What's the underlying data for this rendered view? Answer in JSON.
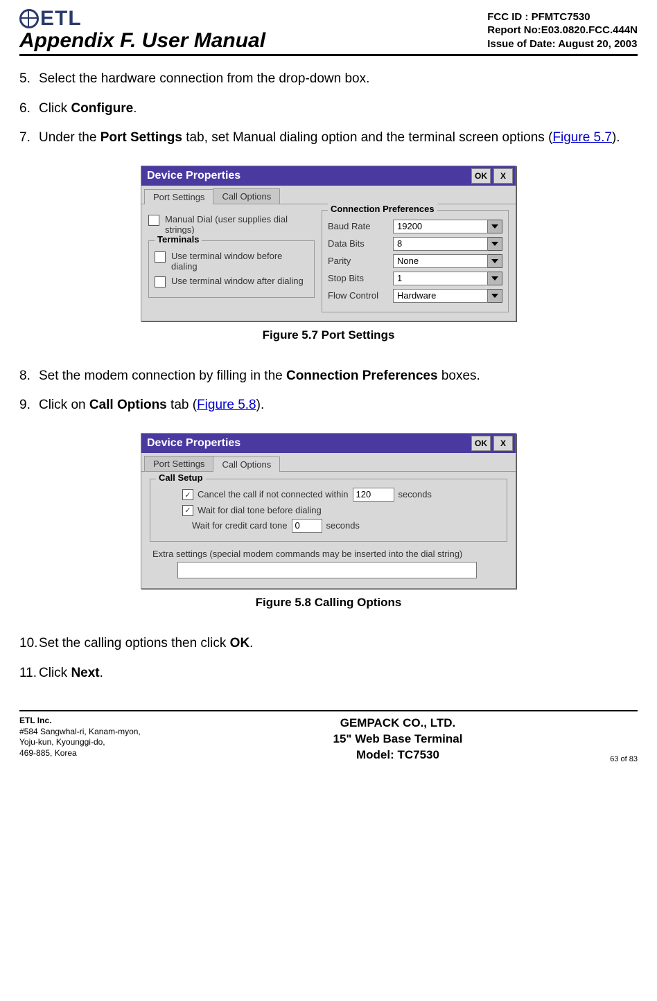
{
  "header": {
    "logo_text": "ETL",
    "title": "Appendix F. User Manual",
    "fcc_id": "FCC ID : PFMTC7530",
    "report_no": "Report No:E03.0820.FCC.444N",
    "issue_date": "Issue of Date:  August 20, 2003"
  },
  "steps": {
    "s5": "Select the hardware connection from the drop-down box.",
    "s6_pre": "Click ",
    "s6_b": "Configure",
    "s6_post": ".",
    "s7_pre": "Under the ",
    "s7_b": "Port Settings",
    "s7_mid": " tab, set Manual dialing option and the terminal screen options (",
    "s7_link": "Figure 5.7",
    "s7_post": ").",
    "s8_pre": "Set the modem connection by filling in the ",
    "s8_b": "Connection Preferences",
    "s8_post": " boxes.",
    "s9_pre": "Click on ",
    "s9_b": "Call Options",
    "s9_mid": " tab (",
    "s9_link": "Figure 5.8",
    "s9_post": ").",
    "s10_pre": "Set the calling options then click ",
    "s10_b": "OK",
    "s10_post": ".",
    "s11_pre": "Click ",
    "s11_b": "Next",
    "s11_post": "."
  },
  "fig57": {
    "caption": "Figure 5.7    Port Settings",
    "title": "Device Properties",
    "ok": "OK",
    "close": "X",
    "tab1": "Port Settings",
    "tab2": "Call Options",
    "manual_dial": "Manual Dial (user supplies dial strings)",
    "terminals_legend": "Terminals",
    "term_before": "Use terminal window before dialing",
    "term_after": "Use terminal window after dialing",
    "conn_pref_legend": "Connection Preferences",
    "baud_lbl": "Baud Rate",
    "baud_val": "19200",
    "databits_lbl": "Data Bits",
    "databits_val": "8",
    "parity_lbl": "Parity",
    "parity_val": "None",
    "stopbits_lbl": "Stop Bits",
    "stopbits_val": "1",
    "flow_lbl": "Flow Control",
    "flow_val": "Hardware"
  },
  "fig58": {
    "caption": "Figure 5.8    Calling Options",
    "title": "Device Properties",
    "ok": "OK",
    "close": "X",
    "tab1": "Port Settings",
    "tab2": "Call Options",
    "call_setup_legend": "Call Setup",
    "cancel_pre": "Cancel the call if not connected within",
    "cancel_val": "120",
    "cancel_post": "seconds",
    "wait_tone": "Wait for dial tone before dialing",
    "credit_pre": "Wait for credit card tone",
    "credit_val": "0",
    "credit_post": "seconds",
    "extra": "Extra settings (special modem commands may be inserted into the dial string)"
  },
  "footer": {
    "company": "ETL Inc.",
    "addr1": "#584 Sangwhal-ri, Kanam-myon,",
    "addr2": "Yoju-kun, Kyounggi-do,",
    "addr3": "469-885, Korea",
    "center1": "GEMPACK CO., LTD.",
    "center2": "15\" Web Base Terminal",
    "center3": "Model: TC7530",
    "page": "63 of  83"
  }
}
